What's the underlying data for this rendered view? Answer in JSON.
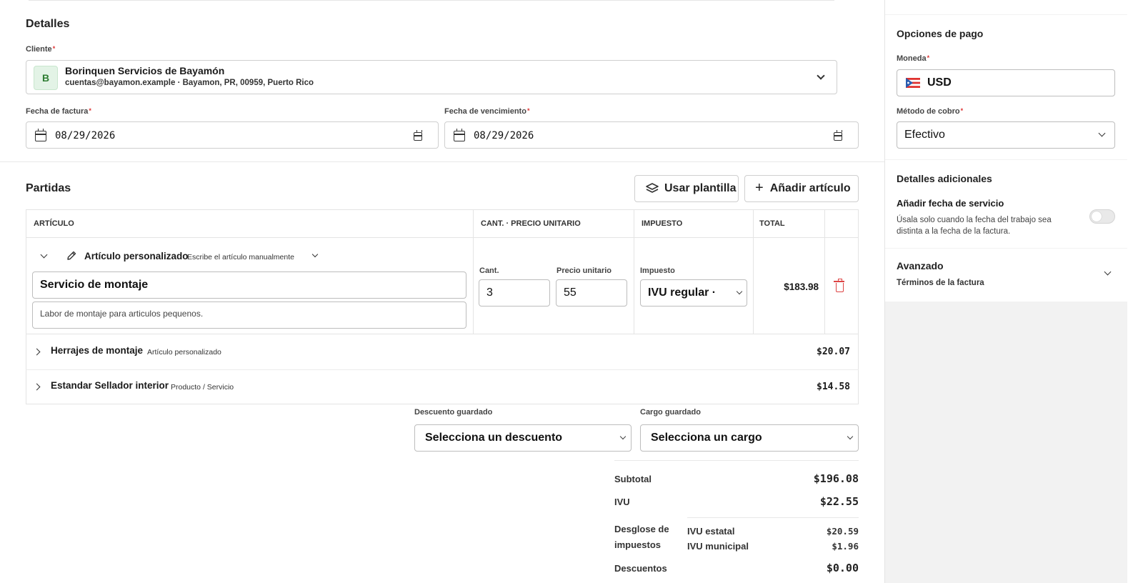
{
  "details": {
    "title": "Detalles",
    "client_label": "Cliente",
    "client_initial": "B",
    "client_name": "Borinquen Servicios de Bayamón",
    "client_sub": "cuentas@bayamon.example · Bayamon, PR, 00959, Puerto Rico",
    "invoice_date_label": "Fecha de factura",
    "invoice_date_value": "08/29/2026",
    "due_date_label": "Fecha de vencimiento",
    "due_date_value": "08/29/2026",
    "required_mark": "*"
  },
  "items": {
    "title": "Partidas",
    "use_template_label": "Usar plantilla",
    "add_item_label": "Añadir artículo",
    "columns": {
      "article": "ARTÍCULO",
      "qty_price_qty": "CANT.",
      "qty_price_price": "· PRECIO UNITARIO",
      "tax": "IMPUESTO",
      "total": "TOTAL"
    },
    "expanded": {
      "type_label": "Artículo personalizado",
      "type_hint": "Escribe el artículo manualmente",
      "name_value": "Servicio de montaje",
      "description_value": "Labor de montaje para articulos pequenos.",
      "qty_label": "Cant.",
      "qty_value": "3",
      "price_label": "Precio unitario",
      "price_value": "55",
      "tax_label": "Impuesto",
      "tax_value": "IVU regular ·",
      "total": "$183.98"
    },
    "rows": [
      {
        "name": "Herrajes de montaje",
        "type": "Artículo personalizado",
        "total": "$20.07"
      },
      {
        "name": "Estandar Sellador interior",
        "type": "Producto / Servicio",
        "total": "$14.58"
      }
    ]
  },
  "adjustments": {
    "discount_label": "Descuento guardado",
    "discount_value": "Selecciona un descuento",
    "charge_label": "Cargo guardado",
    "charge_value": "Selecciona un cargo"
  },
  "summary": {
    "subtotal_label": "Subtotal",
    "subtotal_value": "$196.08",
    "ivu_label": "IVU",
    "ivu_value": "$22.55",
    "breakdown_label_1": "Desglose de",
    "breakdown_label_2": "impuestos",
    "state_label": "IVU estatal",
    "state_value": "$20.59",
    "municipal_label": "IVU municipal",
    "municipal_value": "$1.96",
    "discounts_label": "Descuentos",
    "discounts_value": "$0.00"
  },
  "sidebar": {
    "payment_title": "Opciones de pago",
    "currency_label": "Moneda",
    "currency_value": "USD",
    "method_label": "Método de cobro",
    "method_value": "Efectivo",
    "additional_title": "Detalles adicionales",
    "service_date_title": "Añadir fecha de servicio",
    "service_date_desc_1": "Úsala solo cuando la fecha del trabajo sea",
    "service_date_desc_2": "distinta a la fecha de la factura.",
    "advanced_title": "Avanzado",
    "advanced_sub": "Términos de la factura"
  },
  "colors": {
    "accent_red": "#d44444",
    "client_avatar_bg": "#e3f3e6",
    "sidebar_bg": "#f2f2f2"
  }
}
